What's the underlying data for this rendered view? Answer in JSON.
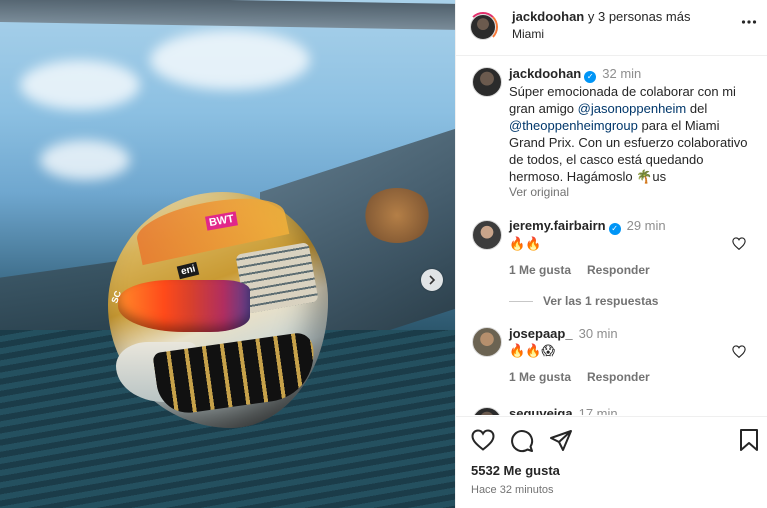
{
  "header": {
    "username": "jackdoohan",
    "with_others": "y 3 personas más",
    "location": "Miami",
    "more_icon": "more-horizontal-icon"
  },
  "caption": {
    "username": "jackdoohan",
    "time": "32 min",
    "text_1": "Súper emocionada de colaborar con mi gran amigo ",
    "mention_1": "@jasonoppenheim",
    "text_2": " del ",
    "mention_2": "@theoppenheimgroup",
    "text_3": " para el Miami Grand Prix. Con un esfuerzo colaborativo de todos, el casco está quedando hermoso. Hagámoslo 🌴us",
    "see_original": "Ver original"
  },
  "comments": [
    {
      "username": "jeremy.fairbairn",
      "verified": true,
      "time": "29 min",
      "text": "🔥🔥",
      "likes_label": "1 Me gusta",
      "reply_label": "Responder",
      "view_replies": "Ver las 1 respuestas"
    },
    {
      "username": "josepaap_",
      "verified": false,
      "time": "30 min",
      "text": "🔥🔥😱",
      "likes_label": "1 Me gusta",
      "reply_label": "Responder"
    },
    {
      "username": "seguveiga",
      "time": "17 min"
    }
  ],
  "footer": {
    "likes": "5532 Me gusta",
    "posted": "Hace 32 minutos"
  },
  "photo": {
    "helmet_logos": [
      "BWT",
      "eni",
      "SC"
    ],
    "carousel_next_icon": "chevron-right-icon"
  },
  "colors": {
    "verified": "#0095f6",
    "mention": "#00376b",
    "secondary_text": "#737373"
  }
}
